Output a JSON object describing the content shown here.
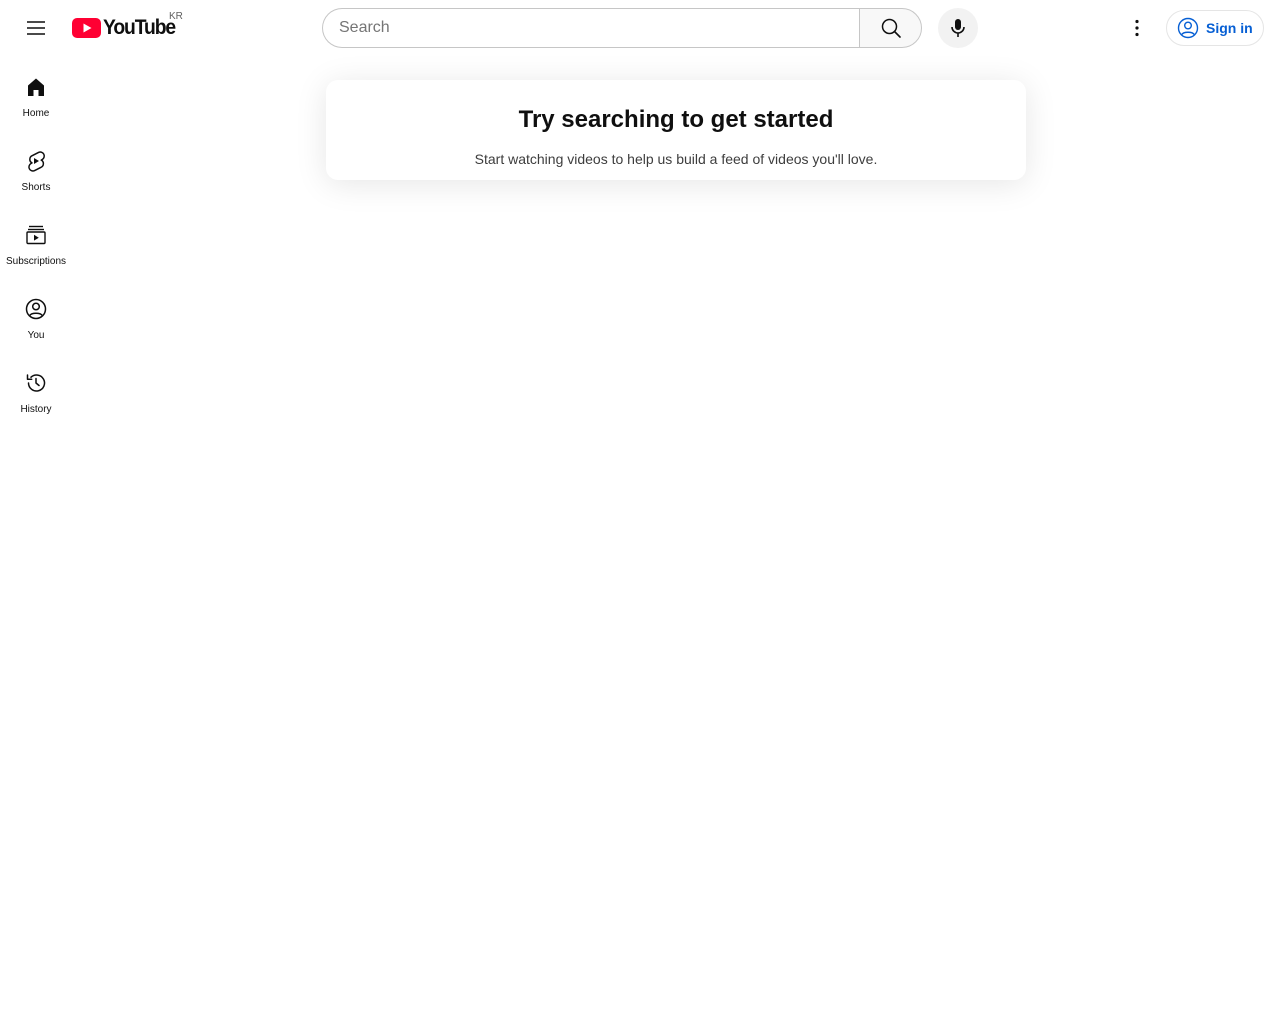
{
  "masthead": {
    "logo_text": "YouTube",
    "country_code": "KR",
    "search": {
      "placeholder": "Search",
      "value": ""
    },
    "signin_label": "Sign in"
  },
  "guide": {
    "items": [
      {
        "label": "Home",
        "icon": "home-icon"
      },
      {
        "label": "Shorts",
        "icon": "shorts-icon"
      },
      {
        "label": "Subscriptions",
        "icon": "subscriptions-icon"
      },
      {
        "label": "You",
        "icon": "you-icon"
      },
      {
        "label": "History",
        "icon": "history-icon"
      }
    ]
  },
  "feed_message": {
    "title": "Try searching to get started",
    "subtitle": "Start watching videos to help us build a feed of videos you'll love."
  },
  "colors": {
    "brand_red": "#ff0033",
    "signin_blue": "#065fd4",
    "text_primary": "#0f0f0f",
    "border": "#c6c6c6"
  }
}
